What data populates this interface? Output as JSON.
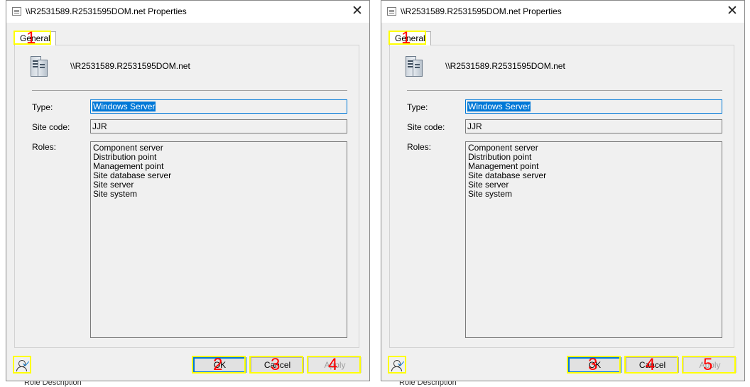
{
  "dialogs": [
    {
      "title": "\\\\R2531589.R2531595DOM.net Properties",
      "close_label": "✕",
      "tab_label": "General",
      "server_name": "\\\\R2531589.R2531595DOM.net",
      "type_label": "Type:",
      "type_value": "Windows Server",
      "site_code_label": "Site code:",
      "site_code_value": "JJR",
      "roles_label": "Roles:",
      "roles": [
        "Component server",
        "Distribution point",
        "Management point",
        "Site database server",
        "Site server",
        "Site system"
      ],
      "ok_label": "OK",
      "cancel_label": "Cancel",
      "apply_label": "Apply",
      "markers": {
        "tab": "1",
        "ok": "2",
        "cancel": "3",
        "apply": "4"
      },
      "below_text": "Role Description"
    },
    {
      "title": "\\\\R2531589.R2531595DOM.net Properties",
      "close_label": "✕",
      "tab_label": "General",
      "server_name": "\\\\R2531589.R2531595DOM.net",
      "type_label": "Type:",
      "type_value": "Windows Server",
      "site_code_label": "Site code:",
      "site_code_value": "JJR",
      "roles_label": "Roles:",
      "roles": [
        "Component server",
        "Distribution point",
        "Management point",
        "Site database server",
        "Site server",
        "Site system"
      ],
      "ok_label": "OK",
      "cancel_label": "Cancel",
      "apply_label": "Apply",
      "markers": {
        "tab": "1",
        "ok": "3",
        "cancel": "4",
        "apply": "5"
      },
      "below_text": "Role Description"
    }
  ],
  "colors": {
    "annotation_box": "#ffff00",
    "annotation_number": "#ff0000",
    "selection": "#0078d7"
  }
}
